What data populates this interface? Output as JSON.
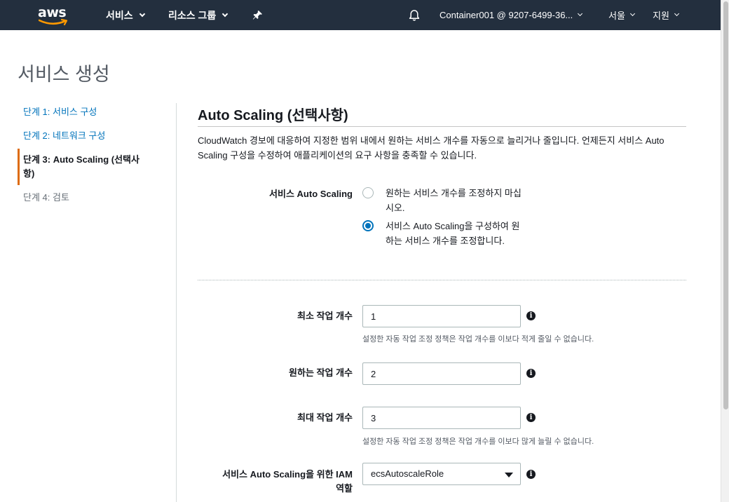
{
  "nav": {
    "logo": "aws",
    "services": "서비스",
    "resource_groups": "리소스 그룹",
    "account": "Container001 @ 9207-6499-36...",
    "region": "서울",
    "support": "지원"
  },
  "page": {
    "title": "서비스 생성"
  },
  "steps": [
    {
      "label": "단계 1: 서비스 구성"
    },
    {
      "label": "단계 2: 네트워크 구성"
    },
    {
      "label": "단계 3: Auto Scaling (선택사항)"
    },
    {
      "label": "단계 4: 검토"
    }
  ],
  "main": {
    "section_title": "Auto Scaling (선택사항)",
    "description": "CloudWatch 경보에 대응하여 지정한 범위 내에서 원하는 서비스 개수를 자동으로 늘리거나 줄입니다. 언제든지 서비스 Auto Scaling 구성을 수정하여 애플리케이션의 요구 사항을 충족할 수 있습니다.",
    "service_auto_scaling_label": "서비스 Auto Scaling",
    "radio_options": [
      {
        "label": "원하는 서비스 개수를 조정하지 마십시오.",
        "selected": false
      },
      {
        "label": "서비스 Auto Scaling을 구성하여 원하는 서비스 개수를 조정합니다.",
        "selected": true
      }
    ],
    "min_tasks": {
      "label": "최소 작업 개수",
      "value": "1",
      "hint": "설정한 자동 작업 조정 정책은 작업 개수를 이보다 적게 줄일 수 없습니다."
    },
    "desired_tasks": {
      "label": "원하는 작업 개수",
      "value": "2"
    },
    "max_tasks": {
      "label": "최대 작업 개수",
      "value": "3",
      "hint": "설정한 자동 작업 조정 정책은 작업 개수를 이보다 많게 늘릴 수 없습니다."
    },
    "iam_role": {
      "label": "서비스 Auto Scaling을 위한 IAM 역할",
      "value": "ecsAutoscaleRole"
    },
    "info_glyph": "i"
  },
  "colors": {
    "nav_bg": "#232f3e",
    "link": "#0073bb",
    "active_step_bar": "#dd6b10",
    "aws_smile": "#ff9900"
  }
}
